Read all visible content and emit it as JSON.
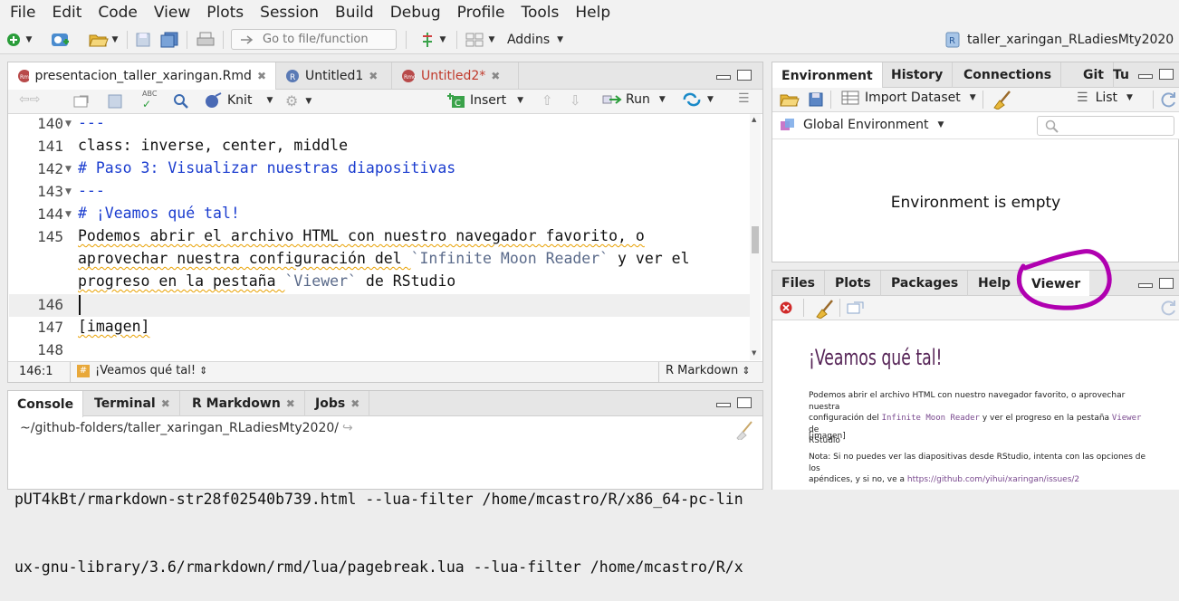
{
  "menu": {
    "file": "File",
    "edit": "Edit",
    "code": "Code",
    "view": "View",
    "plots": "Plots",
    "session": "Session",
    "build": "Build",
    "debug": "Debug",
    "profile": "Profile",
    "tools": "Tools",
    "help": "Help"
  },
  "toolbar": {
    "goto_placeholder": "Go to file/function",
    "addins": "Addins",
    "project": "taller_xaringan_RLadiesMty2020"
  },
  "editor": {
    "tabs": [
      "presentacion_taller_xaringan.Rmd",
      "Untitled1",
      "Untitled2*"
    ],
    "knit": "Knit",
    "insert": "Insert",
    "run": "Run",
    "lines": [
      {
        "n": "140",
        "text": "---"
      },
      {
        "n": "141",
        "text": "class: inverse, center, middle"
      },
      {
        "n": "142",
        "text": "# Paso 3: Visualizar nuestras diapositivas"
      },
      {
        "n": "143",
        "text": "---"
      },
      {
        "n": "144",
        "text": "# ¡Veamos qué tal!"
      },
      {
        "n": "145",
        "l1": "Podemos abrir el archivo HTML con nuestro navegador favorito, o",
        "l2a": "aprovechar nuestra configuración del ",
        "l2b": "`Infinite Moon Reader`",
        "l2c": " y ver el",
        "l3a": "progreso en la pestaña ",
        "l3b": "`Viewer`",
        "l3c": " de RStudio"
      },
      {
        "n": "146",
        "text": ""
      },
      {
        "n": "147",
        "text": "[imagen]"
      },
      {
        "n": "148",
        "text": ""
      }
    ],
    "status_pos": "146:1",
    "status_section": "¡Veamos qué tal!",
    "status_mode": "R Markdown"
  },
  "console": {
    "tabs": [
      "Console",
      "Terminal",
      "R Markdown",
      "Jobs"
    ],
    "path": "~/github-folders/taller_xaringan_RLadiesMty2020/",
    "lines": [
      "pUT4kBt/rmarkdown-str28f02540b739.html --lua-filter /home/mcastro/R/x86_64-pc-lin",
      "ux-gnu-library/3.6/rmarkdown/rmd/lua/pagebreak.lua --lua-filter /home/mcastro/R/x"
    ]
  },
  "env": {
    "tabs": [
      "Environment",
      "History",
      "Connections",
      "Git",
      "Tu"
    ],
    "import": "Import Dataset",
    "list": "List",
    "global": "Global Environment",
    "empty": "Environment is empty"
  },
  "viewer_pane": {
    "tabs": [
      "Files",
      "Plots",
      "Packages",
      "Help",
      "Viewer"
    ],
    "slide_title": "¡Veamos qué tal!",
    "p1a": "Podemos abrir el archivo HTML con nuestro navegador favorito, o aprovechar nuestra",
    "p1b": "configuración del ",
    "p1c": "Infinite Moon Reader",
    "p1d": " y ver el progreso en la pestaña ",
    "p1e": "Viewer",
    "p1f": " de",
    "p1g": "RStudio",
    "p2": "[imagen]",
    "p3a": "Nota: Si no puedes ver las diapositivas desde RStudio, intenta con las opciones de los",
    "p3b": "apéndices, y si no, ve a ",
    "p3c": "https://github.com/yihui/xaringan/issues/2"
  },
  "colors": {
    "annotation_circle": "#b000b0",
    "slide_title": "#562457"
  }
}
